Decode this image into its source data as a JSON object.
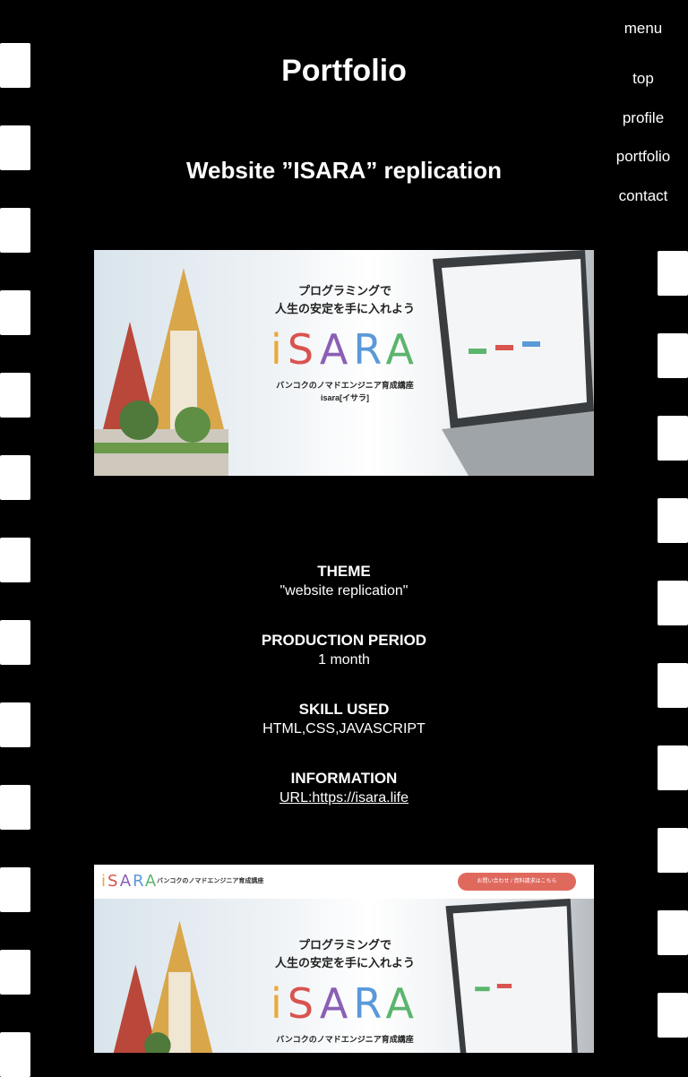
{
  "nav": {
    "menu_label": "menu",
    "items": [
      {
        "label": "top"
      },
      {
        "label": "profile"
      },
      {
        "label": "portfolio"
      },
      {
        "label": "contact"
      }
    ]
  },
  "page": {
    "title": "Portfolio",
    "subtitle": "Website ”ISARA” replication"
  },
  "banner": {
    "headline_line1": "プログラミングで",
    "headline_line2": "人生の安定を手に入れよう",
    "logo": "iSARA",
    "tagline": "バンコクのノマドエンジニア育成講座",
    "brand": "isara[イサラ]"
  },
  "banner2": {
    "header_logo": "iSARA",
    "header_tagline": "バンコクのノマドエンジニア育成講座",
    "cta": "お問い合わせ / 資料請求はこちら",
    "headline_line1": "プログラミングで",
    "headline_line2": "人生の安定を手に入れよう",
    "logo": "iSARA",
    "tagline": "バンコクのノマドエンジニア育成講座"
  },
  "info": {
    "theme_label": "THEME",
    "theme_value": "\"website replication\"",
    "period_label": "PRODUCTION PERIOD",
    "period_value": "1 month",
    "skill_label": "SKILL USED",
    "skill_value": "HTML,CSS,JAVASCRIPT",
    "information_label": "INFORMATION",
    "information_link": "URL:https://isara.life"
  }
}
